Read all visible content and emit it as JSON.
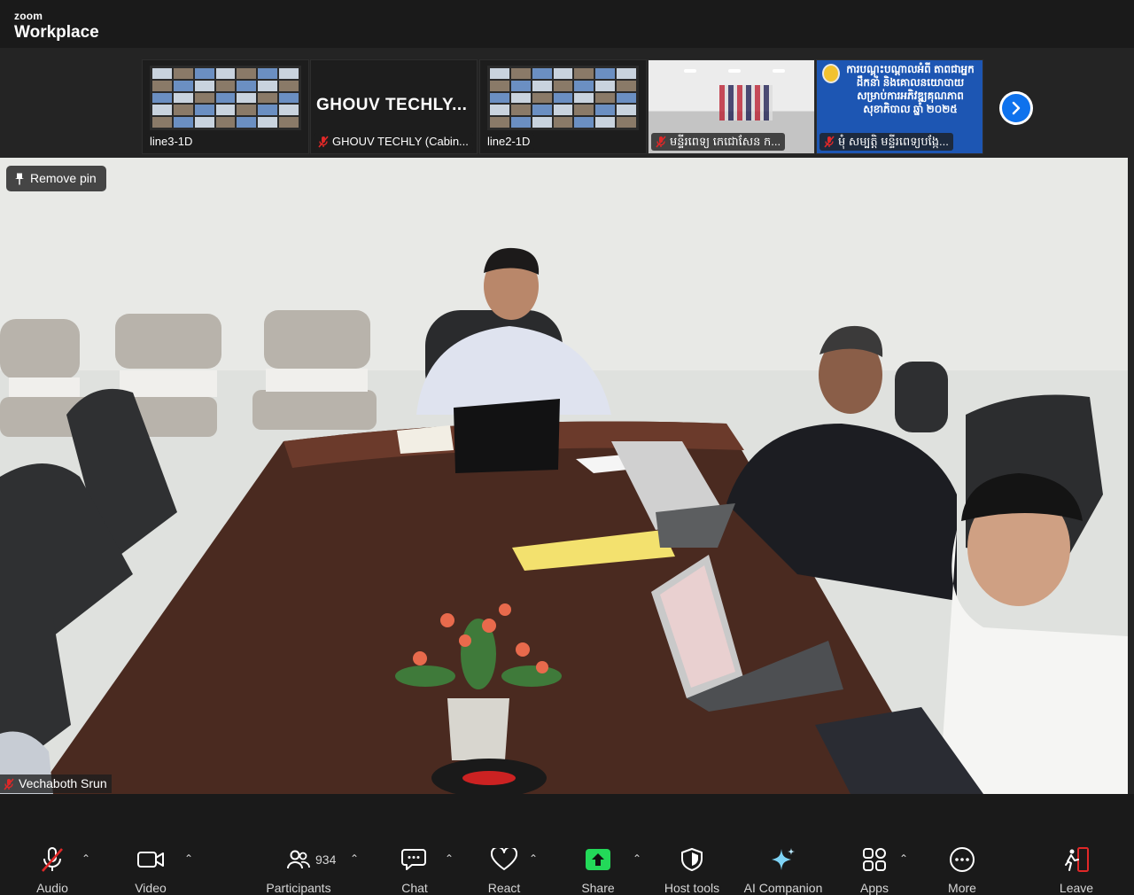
{
  "app": {
    "brand_small": "zoom",
    "brand_large": "Workplace"
  },
  "gallery": {
    "tiles": [
      {
        "label": "line3-1D",
        "muted": false,
        "kind": "grid"
      },
      {
        "label": "GHOUV TECHLY (Cabin...",
        "muted": true,
        "kind": "name",
        "big_name": "GHOUV TECHLY..."
      },
      {
        "label": "line2-1D",
        "muted": false,
        "kind": "grid"
      },
      {
        "label": "មន្ទីរពេទ្យ កេជោសែន ក...",
        "muted": true,
        "kind": "room"
      },
      {
        "label": "មុំ សម្បត្តិ មន្ទីរពេទ្យបង្កែ...",
        "muted": true,
        "kind": "banner",
        "banner_text": "ការបណ្តុះបណ្តាលអំពី តាពជាអ្នកដឹកនាំ និងគោលនយោបាយ សម្រាប់ការអភិវឌ្ឍគុណភាពសុខាភិបាល ឆ្នាំ ២០២៥"
      }
    ],
    "next_icon": "chevron-right-icon"
  },
  "main_video": {
    "remove_pin_label": "Remove pin",
    "speaker_name": "Vechaboth Srun",
    "speaker_muted": true
  },
  "toolbar": {
    "audio": "Audio",
    "video": "Video",
    "participants": "Participants",
    "participants_count": "934",
    "chat": "Chat",
    "react": "React",
    "share": "Share",
    "host_tools": "Host tools",
    "ai_companion": "AI Companion",
    "apps": "Apps",
    "more": "More",
    "leave": "Leave"
  },
  "colors": {
    "accent": "#0e72ed",
    "share_green": "#23d959",
    "mute_red": "#e02828",
    "leave_red": "#e02828"
  }
}
